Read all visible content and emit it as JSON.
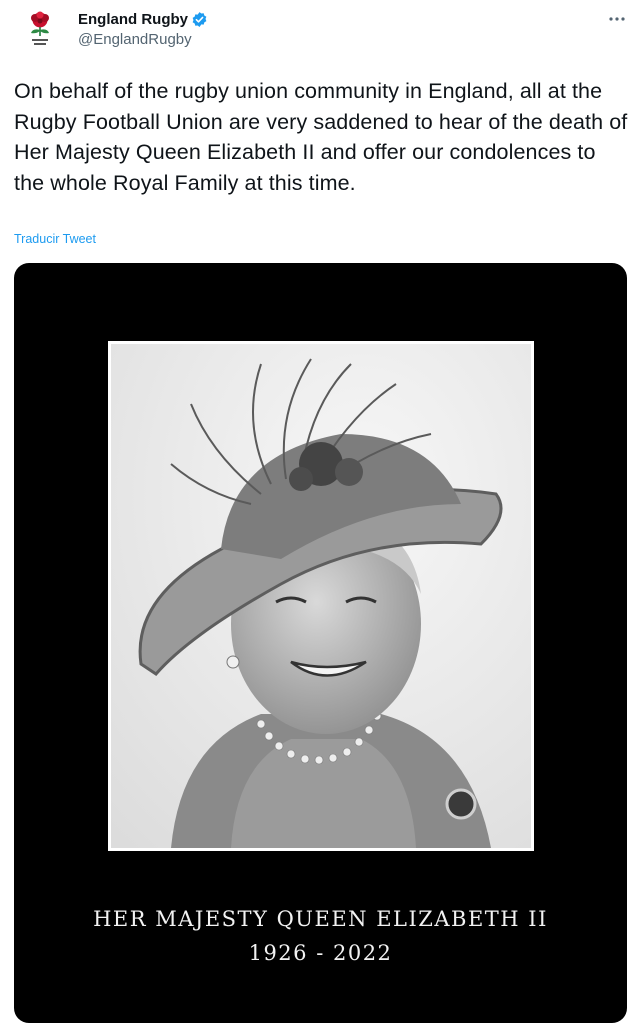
{
  "tweet": {
    "author": {
      "display_name": "England Rugby",
      "handle": "@EnglandRugby",
      "verified": true,
      "avatar_icon": "rose-logo-icon"
    },
    "more_icon": "more-options-icon",
    "text": "On behalf of the rugby union community in England, all at the Rugby Football Union are very saddened to hear of the death of Her Majesty Queen Elizabeth II and offer our condolences to the whole Royal Family at this time.",
    "translate_label": "Traducir Tweet"
  },
  "media": {
    "caption_title": "HER MAJESTY QUEEN ELIZABETH II",
    "caption_years": "1926 - 2022"
  },
  "colors": {
    "link": "#1d9bf0",
    "verified": "#1d9bf0",
    "text_primary": "#0f1419",
    "text_secondary": "#536471",
    "media_background": "#000000",
    "rose": "#c8102e"
  }
}
